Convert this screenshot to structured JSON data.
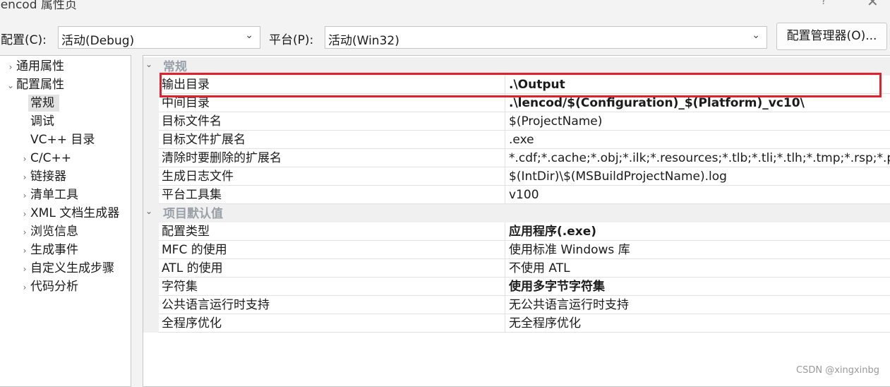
{
  "window": {
    "title": "lencod 属性页",
    "help": "?",
    "close": "✕"
  },
  "toolbar": {
    "config_label": "配置(C):",
    "config_value": "活动(Debug)",
    "platform_label": "平台(P):",
    "platform_value": "活动(Win32)",
    "manager_button": "配置管理器(O)..."
  },
  "tree": {
    "items": [
      {
        "label": "通用属性",
        "arrow": "›"
      },
      {
        "label": "配置属性",
        "arrow": "⌄"
      },
      {
        "label": "常规",
        "arrow": ""
      },
      {
        "label": "调试",
        "arrow": ""
      },
      {
        "label": "VC++ 目录",
        "arrow": ""
      },
      {
        "label": "C/C++",
        "arrow": "›"
      },
      {
        "label": "链接器",
        "arrow": "›"
      },
      {
        "label": "清单工具",
        "arrow": "›"
      },
      {
        "label": "XML 文档生成器",
        "arrow": "›"
      },
      {
        "label": "浏览信息",
        "arrow": "›"
      },
      {
        "label": "生成事件",
        "arrow": "›"
      },
      {
        "label": "自定义生成步骤",
        "arrow": "›"
      },
      {
        "label": "代码分析",
        "arrow": "›"
      }
    ]
  },
  "grid": {
    "sections": [
      {
        "title": "常规",
        "rows": [
          {
            "name": "输出目录",
            "value": ".\\Output",
            "bold": true
          },
          {
            "name": "中间目录",
            "value": ".\\lencod/$(Configuration)_$(Platform)_vc10\\",
            "bold": true
          },
          {
            "name": "目标文件名",
            "value": "$(ProjectName)",
            "bold": false
          },
          {
            "name": "目标文件扩展名",
            "value": ".exe",
            "bold": false
          },
          {
            "name": "清除时要删除的扩展名",
            "value": "*.cdf;*.cache;*.obj;*.ilk;*.resources;*.tlb;*.tli;*.tlh;*.tmp;*.rsp;*.pgc",
            "bold": false
          },
          {
            "name": "生成日志文件",
            "value": "$(IntDir)\\$(MSBuildProjectName).log",
            "bold": false
          },
          {
            "name": "平台工具集",
            "value": "v100",
            "bold": false
          }
        ]
      },
      {
        "title": "项目默认值",
        "rows": [
          {
            "name": "配置类型",
            "value": "应用程序(.exe)",
            "bold": true
          },
          {
            "name": "MFC 的使用",
            "value": "使用标准 Windows 库",
            "bold": false
          },
          {
            "name": "ATL 的使用",
            "value": "不使用 ATL",
            "bold": false
          },
          {
            "name": "字符集",
            "value": "使用多字节字符集",
            "bold": true
          },
          {
            "name": "公共语言运行时支持",
            "value": "无公共语言运行时支持",
            "bold": false
          },
          {
            "name": "全程序优化",
            "value": "无全程序优化",
            "bold": false
          }
        ]
      }
    ]
  },
  "highlight_color": "#e0202a",
  "watermark": "CSDN @xingxinbg"
}
